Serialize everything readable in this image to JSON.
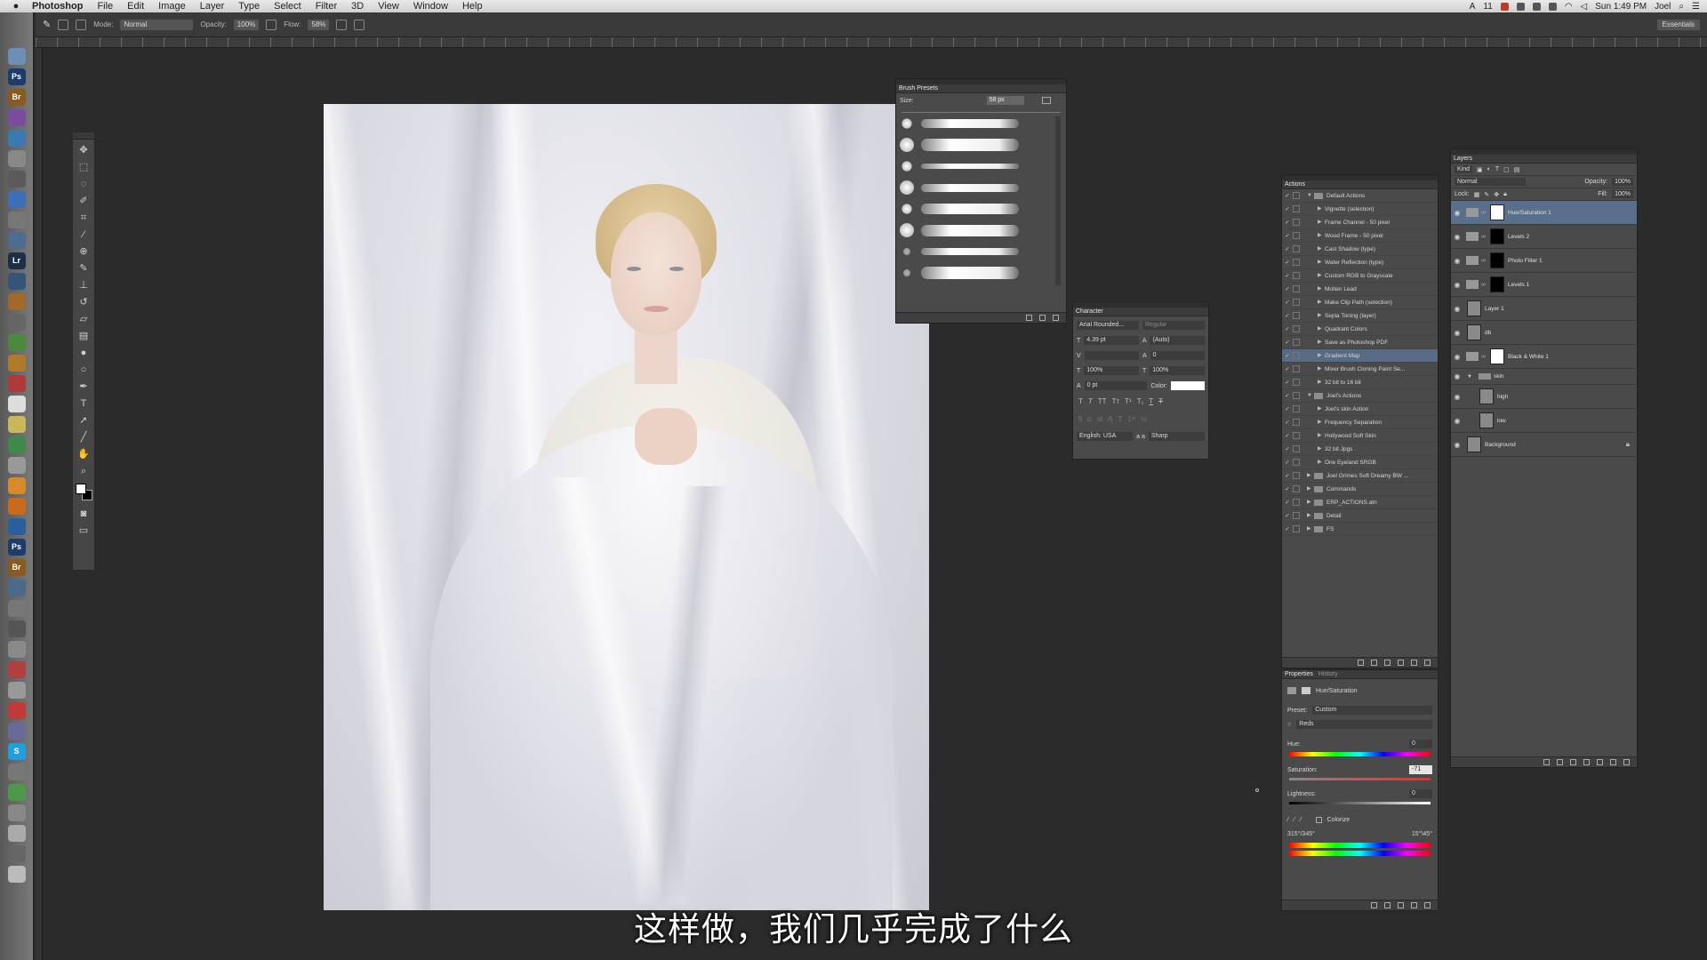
{
  "menubar": {
    "app_name": "Photoshop",
    "items": [
      "File",
      "Edit",
      "Image",
      "Layer",
      "Type",
      "Select",
      "Filter",
      "3D",
      "View",
      "Window",
      "Help"
    ],
    "status": {
      "battery": "11",
      "clock": "Sun 1:49 PM",
      "user": "Joel"
    }
  },
  "options_bar": {
    "mode_label": "Mode:",
    "mode_value": "Normal",
    "opacity_label": "Opacity:",
    "opacity_value": "100%",
    "flow_label": "Flow:",
    "flow_value": "58%",
    "workspace": "Essentials"
  },
  "brush_presets": {
    "title": "Brush Presets",
    "size_label": "Size:",
    "size_value": "58 px"
  },
  "character": {
    "title": "Character",
    "font_family": "Arial Rounded...",
    "font_style": "Regular",
    "font_size": "4.39 pt",
    "leading": "(Auto)",
    "tracking": "0",
    "vertical_scale": "100%",
    "horizontal_scale": "100%",
    "baseline": "0 pt",
    "color_label": "Color:",
    "language": "English: USA",
    "aa_label": "a a",
    "antialias": "Sharp"
  },
  "actions": {
    "title": "Actions",
    "items": [
      {
        "label": "Default Actions",
        "level": 0,
        "folder": true,
        "expanded": true
      },
      {
        "label": "Vignette (selection)",
        "level": 1
      },
      {
        "label": "Frame Channel - 50 pixel",
        "level": 1
      },
      {
        "label": "Wood Frame - 50 pixel",
        "level": 1
      },
      {
        "label": "Cast Shadow (type)",
        "level": 1
      },
      {
        "label": "Water Reflection (type)",
        "level": 1
      },
      {
        "label": "Custom RGB to Grayscale",
        "level": 1
      },
      {
        "label": "Molten Lead",
        "level": 1
      },
      {
        "label": "Make Clip Path (selection)",
        "level": 1
      },
      {
        "label": "Sepia Toning (layer)",
        "level": 1
      },
      {
        "label": "Quadrant Colors",
        "level": 1
      },
      {
        "label": "Save as Photoshop PDF",
        "level": 1
      },
      {
        "label": "Gradient Map",
        "level": 1,
        "selected": true
      },
      {
        "label": "Mixer Brush Cloning Paint Se...",
        "level": 1
      },
      {
        "label": "32 bit to 16 bit",
        "level": 1
      },
      {
        "label": "Joel's Actions",
        "level": 0,
        "folder": true,
        "expanded": true
      },
      {
        "label": "Joel's skin Action",
        "level": 1
      },
      {
        "label": "Frequency Separation",
        "level": 1
      },
      {
        "label": "Hollywood Soft Skin",
        "level": 1
      },
      {
        "label": "32 bit Jpgs",
        "level": 1
      },
      {
        "label": "One Eyeland SRGB",
        "level": 1
      },
      {
        "label": "Joel Grimes Soft Dreamy BW ...",
        "level": 0,
        "folder": true
      },
      {
        "label": "Commands",
        "level": 0,
        "folder": true
      },
      {
        "label": "ERP_ACTIONS.atn",
        "level": 0,
        "folder": true
      },
      {
        "label": "Detail",
        "level": 0,
        "folder": true
      },
      {
        "label": "FS",
        "level": 0,
        "folder": true
      }
    ]
  },
  "properties": {
    "tabs": [
      "Properties",
      "History"
    ],
    "header": "Hue/Saturation",
    "preset_label": "Preset:",
    "preset_value": "Custom",
    "channel_value": "Reds",
    "hue_label": "Hue:",
    "hue_value": "0",
    "saturation_label": "Saturation:",
    "saturation_value": "-71",
    "lightness_label": "Lightness:",
    "lightness_value": "0",
    "colorize_label": "Colorize",
    "range_left": "315°/345°",
    "range_right": "15°\\45°"
  },
  "layers": {
    "title": "Layers",
    "kind_label": "Kind",
    "blend_mode": "Normal",
    "opacity_label": "Opacity:",
    "opacity_value": "100%",
    "lock_label": "Lock:",
    "fill_label": "Fill:",
    "fill_value": "100%",
    "items": [
      {
        "name": "Hue/Saturation 1",
        "type": "adjustment",
        "mask": "white",
        "selected": true
      },
      {
        "name": "Levels 2",
        "type": "adjustment",
        "mask": "black"
      },
      {
        "name": "Photo Filter 1",
        "type": "adjustment",
        "mask": "black"
      },
      {
        "name": "Levels 1",
        "type": "adjustment",
        "mask": "black"
      },
      {
        "name": "Layer 1",
        "type": "pixel",
        "mask": "gray"
      },
      {
        "name": "db",
        "type": "pixel",
        "mask": "gray"
      },
      {
        "name": "Black & White 1",
        "type": "adjustment",
        "mask": "white"
      },
      {
        "name": "skin",
        "type": "group"
      },
      {
        "name": "high",
        "type": "pixel",
        "mask": "gray",
        "indent": true
      },
      {
        "name": "low",
        "type": "pixel",
        "mask": "gray",
        "indent": true
      },
      {
        "name": "Background",
        "type": "pixel",
        "mask": "gray",
        "locked": true
      }
    ]
  },
  "subtitle": "这样做，我们几乎完成了什么"
}
